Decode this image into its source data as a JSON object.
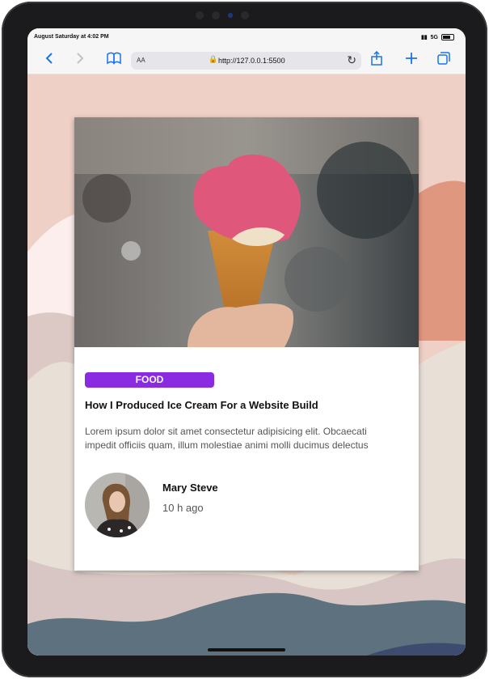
{
  "status_bar": {
    "time": "August Saturday at 4:02 PM",
    "network": "5G"
  },
  "browser": {
    "back_icon": "chevron-left-icon",
    "forward_icon": "chevron-right-icon",
    "reader_label": "AA",
    "url": "http://127.0.0.1:5500",
    "icons": [
      "book-icon",
      "lock-icon",
      "reload-icon",
      "share-icon",
      "plus-icon",
      "tabs-icon"
    ]
  },
  "card": {
    "category": "FOOD",
    "title": "How I Produced Ice Cream For a Website Build",
    "description_line1": "Lorem ipsum dolor sit amet consectetur adipisicing elit. Obcaecati",
    "description_line2": "impedit officiis quam, illum molestiae animi molli ducimus delectus",
    "author": "Mary Steve",
    "time_ago": "10 h ago"
  },
  "colors": {
    "accent": "#8a2be2",
    "background_peach": "#efd0c6",
    "wave_orange": "#e09780",
    "wave_slate": "#5d717f"
  }
}
